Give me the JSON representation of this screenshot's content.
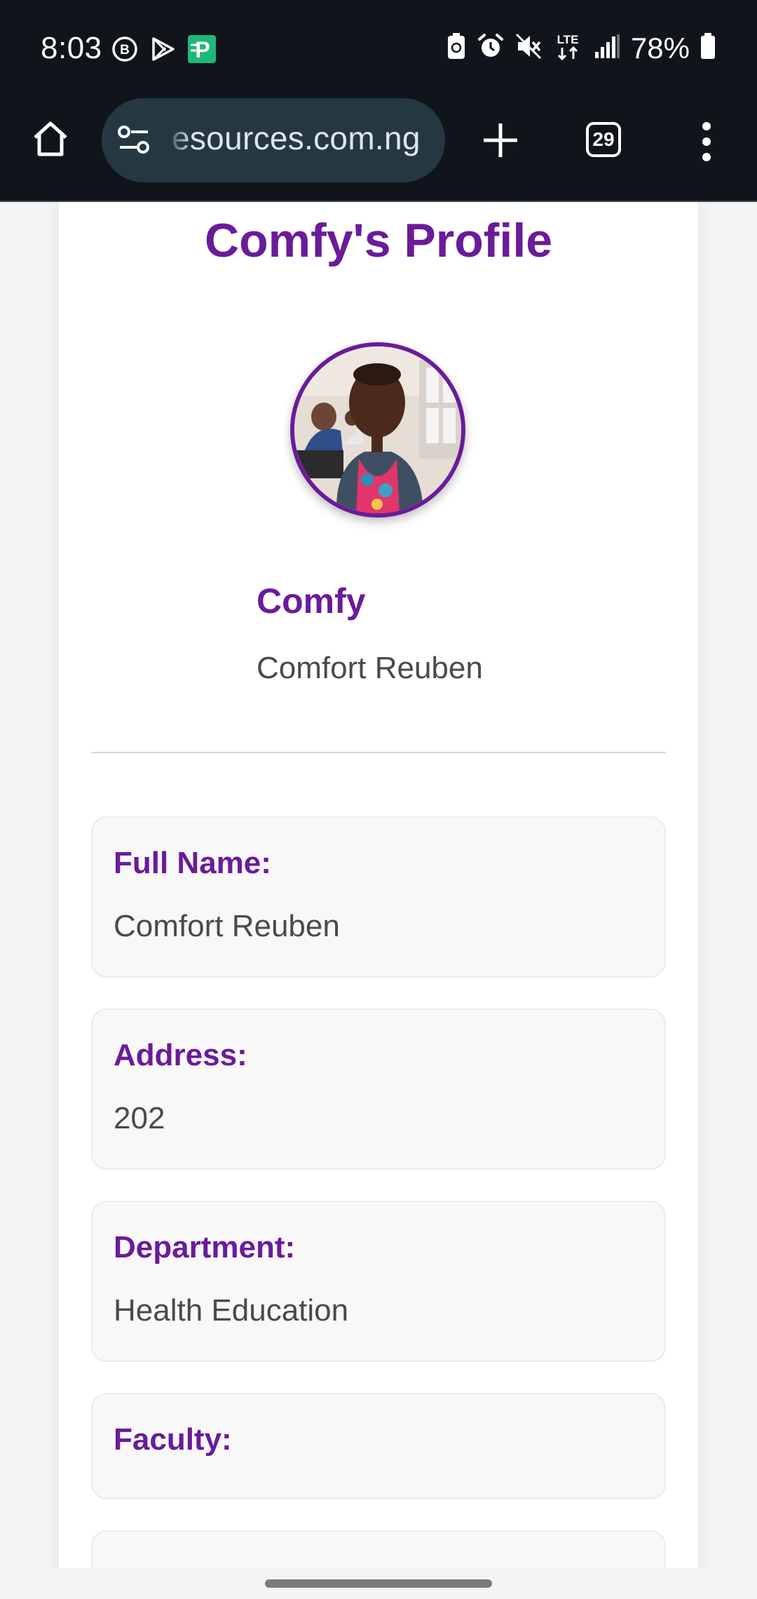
{
  "status_bar": {
    "time": "8:03",
    "battery_percent": "78%",
    "network_type": "LTE",
    "left_icons": [
      "bip-icon",
      "play-store-icon",
      "app-p-icon"
    ],
    "right_icons": [
      "battery-saver-icon",
      "alarm-icon",
      "mute-icon",
      "lte-icon",
      "signal-icon",
      "battery-icon"
    ]
  },
  "browser": {
    "url": "esources.com.ng",
    "tab_count": "29"
  },
  "profile": {
    "title": "Comfy's Profile",
    "username": "Comfy",
    "real_name": "Comfort Reuben",
    "fields": [
      {
        "label": "Full Name:",
        "value": "Comfort Reuben"
      },
      {
        "label": "Address:",
        "value": "202"
      },
      {
        "label": "Department:",
        "value": "Health Education"
      },
      {
        "label": "Faculty:",
        "value": ""
      }
    ]
  },
  "colors": {
    "accent": "#6a1b9a",
    "status_bg": "#0f151b",
    "url_bar_bg": "#253841",
    "text_muted": "#4a4a4a"
  }
}
